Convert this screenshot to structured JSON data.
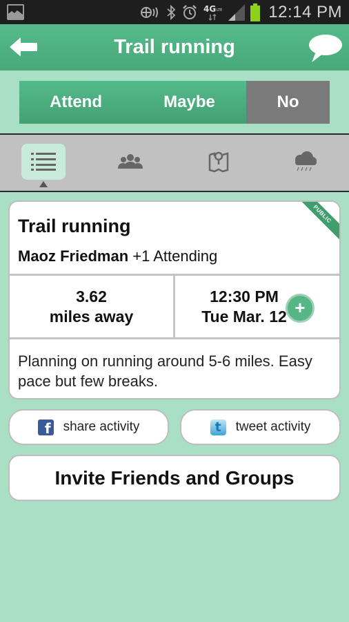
{
  "status_bar": {
    "time": "12:14 PM",
    "network": "4G LTE",
    "icons": [
      "gallery-icon",
      "nfc-icon",
      "bluetooth-icon",
      "alarm-icon",
      "4g-lte-icon",
      "signal-icon",
      "battery-icon"
    ],
    "battery_color": "#8fd11a"
  },
  "header": {
    "title": "Trail running",
    "back_icon": "arrow-left-icon",
    "chat_icon": "speech-bubble-icon"
  },
  "rsvp": {
    "attend_label": "Attend",
    "maybe_label": "Maybe",
    "no_label": "No",
    "selected": "No"
  },
  "tabs": {
    "items": [
      {
        "icon": "list-icon",
        "active": true
      },
      {
        "icon": "group-icon",
        "active": false
      },
      {
        "icon": "map-pin-icon",
        "active": false
      },
      {
        "icon": "rain-cloud-icon",
        "active": false
      }
    ]
  },
  "activity": {
    "title": "Trail running",
    "badge": "PUBLIC",
    "organizer": "Maoz Friedman",
    "attending_suffix": "+1 Attending",
    "distance_value": "3.62",
    "distance_unit": "miles away",
    "time": "12:30 PM",
    "date": "Tue Mar. 12",
    "add_calendar_label": "+",
    "description": "Planning on running around 5-6 miles. Easy pace but few breaks."
  },
  "share": {
    "facebook_label": "share activity",
    "twitter_label": "tweet activity"
  },
  "invite": {
    "label": "Invite Friends and Groups"
  },
  "colors": {
    "accent": "#4fb585",
    "background": "#a9dfc5",
    "selected_rsvp": "#7a7a7a",
    "tab_bar": "#c1c1c1"
  }
}
